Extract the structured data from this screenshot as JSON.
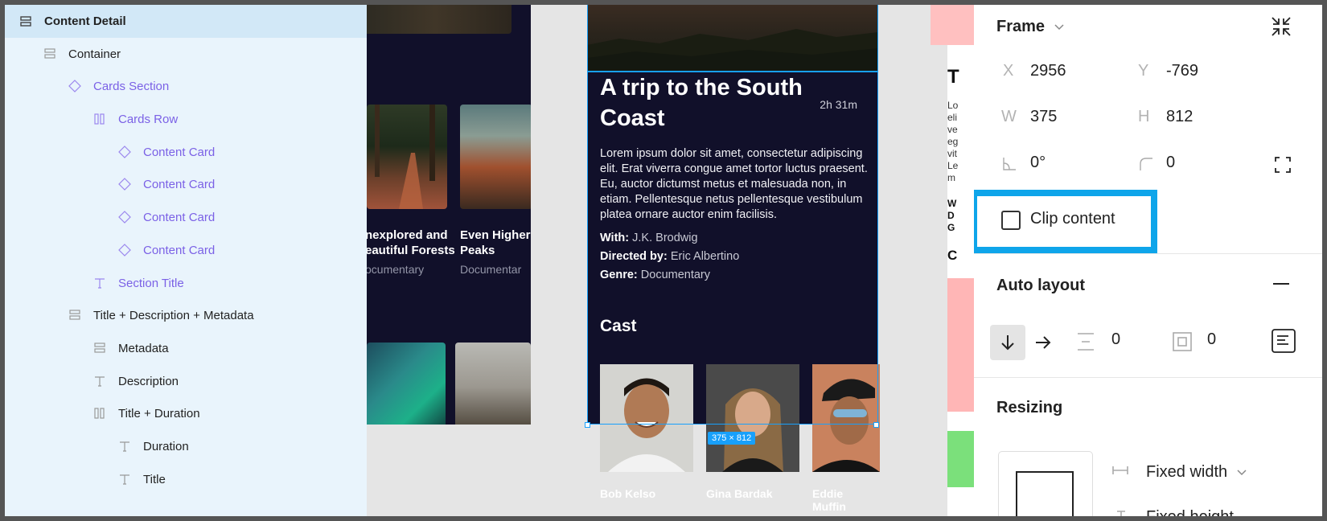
{
  "layers": [
    {
      "label": "Content Detail",
      "icon": "frame-stack-icon",
      "selected": true
    },
    {
      "label": "Container",
      "icon": "frame-stack-icon"
    },
    {
      "label": "Cards Section",
      "icon": "component-instance-icon"
    },
    {
      "label": "Cards Row",
      "icon": "frame-columns-icon"
    },
    {
      "label": "Content Card",
      "icon": "component-instance-icon"
    },
    {
      "label": "Content Card",
      "icon": "component-instance-icon"
    },
    {
      "label": "Content Card",
      "icon": "component-instance-icon"
    },
    {
      "label": "Content Card",
      "icon": "component-instance-icon"
    },
    {
      "label": "Section Title",
      "icon": "text-icon"
    },
    {
      "label": "Title + Description + Metadata",
      "icon": "frame-stack-icon"
    },
    {
      "label": "Metadata",
      "icon": "frame-stack-icon"
    },
    {
      "label": "Description",
      "icon": "text-icon"
    },
    {
      "label": "Title + Duration",
      "icon": "frame-columns-icon"
    },
    {
      "label": "Duration",
      "icon": "text-icon"
    },
    {
      "label": "Title",
      "icon": "text-icon"
    }
  ],
  "canvas": {
    "left_frame": {
      "cards": [
        {
          "title": "Unexplored and Beautiful Forests",
          "title_visible": "nexplored and\neautiful Forests",
          "subtitle": "ocumentary"
        },
        {
          "title": "Even Higher Peaks",
          "title_visible": "Even Higher\nPeaks",
          "subtitle": "Documentar"
        }
      ]
    },
    "detail": {
      "title": "A trip to the South Coast",
      "duration": "2h 31m",
      "description": "Lorem ipsum dolor sit amet, consectetur adipiscing elit. Erat viverra congue amet tortor luctus praesent. Eu, auctor dictumst metus et malesuada non, in etiam. Pellentesque netus pellentesque vestibulum platea ornare auctor enim facilisis.",
      "with_label": "With:",
      "with_value": "J.K. Brodwig",
      "directed_label": "Directed by:",
      "directed_value": "Eric Albertino",
      "genre_label": "Genre:",
      "genre_value": "Documentary",
      "cast_title": "Cast",
      "cast": [
        "Bob Kelso",
        "Gina Bardak",
        "Eddie Muffin"
      ],
      "size_badge": "375 × 812"
    },
    "right_frame": {
      "letters": [
        "T",
        "Lo",
        "eli",
        "ve",
        "eg",
        "vit",
        "Le",
        "m",
        "W",
        "D",
        "G",
        "C"
      ]
    }
  },
  "properties": {
    "frame_label": "Frame",
    "x_label": "X",
    "x_value": "2956",
    "y_label": "Y",
    "y_value": "-769",
    "w_label": "W",
    "w_value": "375",
    "h_label": "H",
    "h_value": "812",
    "rotation_value": "0°",
    "radius_value": "0",
    "clip_content_label": "Clip content",
    "clip_content_checked": false,
    "auto_layout_label": "Auto layout",
    "spacing_value": "0",
    "padding_value": "0",
    "resizing_label": "Resizing",
    "fixed_width_label": "Fixed width",
    "fixed_height_label": "Fixed height"
  },
  "colors": {
    "selection": "#18a0fb",
    "clip_highlight": "#0ea5ea",
    "layers_bg": "#e9f4fc",
    "component_purple": "#7b61e6",
    "frame_dark": "#11102a"
  }
}
